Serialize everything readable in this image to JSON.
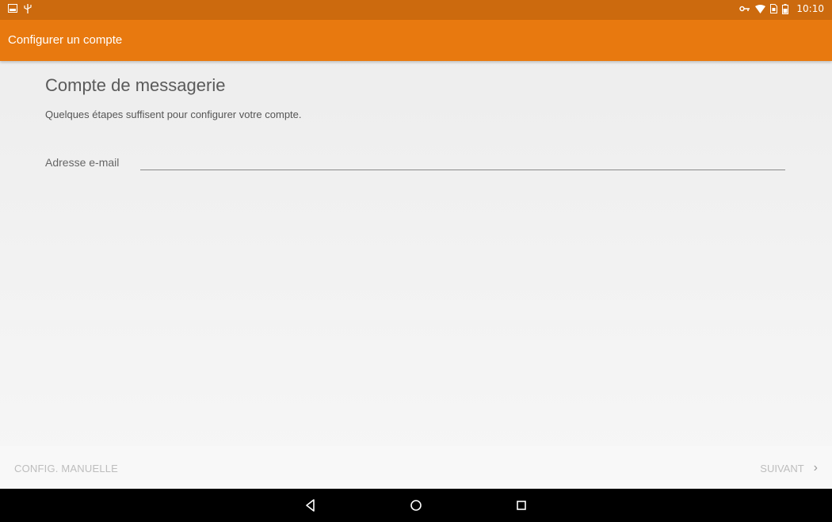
{
  "status_bar": {
    "left_icons": [
      "image-icon",
      "usb-icon"
    ],
    "right_icons": [
      "vpn-key-icon",
      "wifi-icon",
      "sim-icon",
      "battery-icon"
    ],
    "time": "10:10"
  },
  "toolbar": {
    "title": "Configurer un compte"
  },
  "main": {
    "heading": "Compte de messagerie",
    "subheading": "Quelques étapes suffisent pour configurer votre compte.",
    "email_label": "Adresse e-mail",
    "email_value": "",
    "email_placeholder": ""
  },
  "footer": {
    "manual_label": "CONFIG. MANUELLE",
    "next_label": "SUIVANT",
    "next_icon": "chevron-right-icon"
  },
  "nav_bar": {
    "buttons": [
      "back-icon",
      "home-icon",
      "recents-icon"
    ]
  },
  "colors": {
    "status_bar": "#cc6a0e",
    "toolbar": "#e8790f",
    "background": "#efefef",
    "disabled_text": "#bdbdbd"
  }
}
